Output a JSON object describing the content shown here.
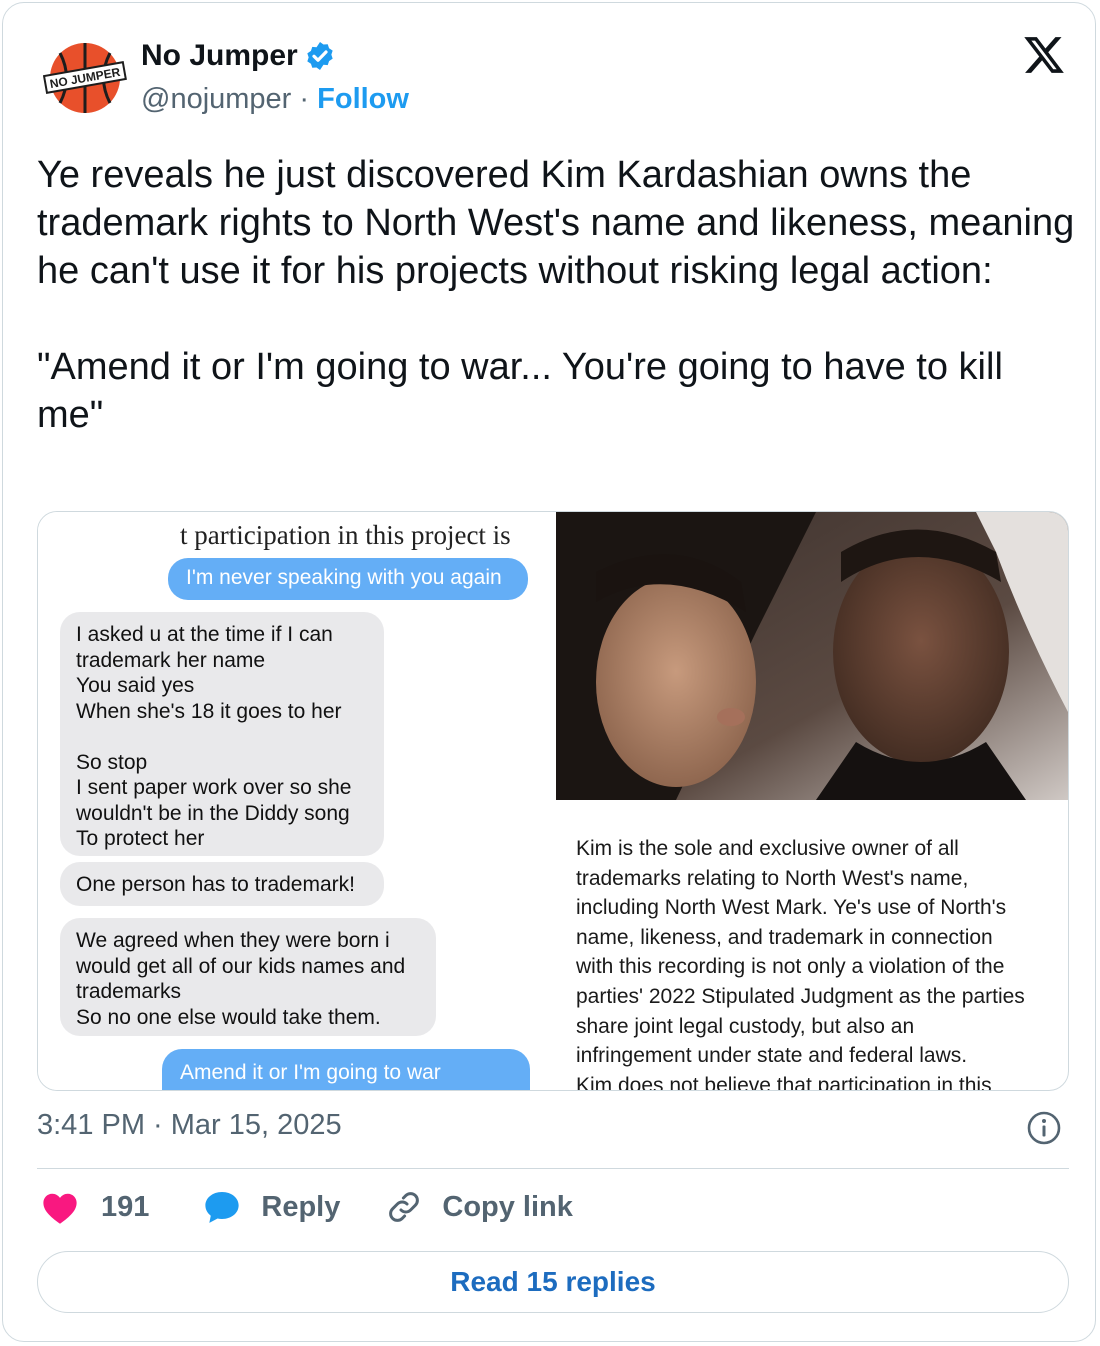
{
  "header": {
    "display_name": "No Jumper",
    "handle": "@nojumper",
    "separator": "·",
    "follow_label": "Follow",
    "avatar_text": "NO JUMPER"
  },
  "tweet": {
    "text": "Ye reveals he just discovered Kim Kardashian owns the trademark rights to North West's name and likeness, meaning he can't use it for his projects without risking legal action:\n\n\"Amend it or I'm going to war... You're going to have to kill me\""
  },
  "media": {
    "chat": {
      "header_fragment": "t participation in this project is",
      "msg1": "I'm never speaking with you again",
      "msg2": "I asked u at the time if I can\ntrademark her name\nYou said yes\nWhen she's 18 it goes to her\n\nSo stop\nI sent paper work over so she\nwouldn't be in the Diddy song\nTo protect her",
      "msg3": "One person has to trademark!",
      "msg4": "We agreed when they were born i\nwould get all of our kids names and\ntrademarks\nSo no one else would take them.",
      "msg5": "Amend it or I'm going to war"
    },
    "document_text": "Kim is the sole and exclusive owner of all\ntrademarks relating to North West's name,\nincluding North West Mark. Ye's use of North's\nname, likeness, and trademark in connection\nwith this recording is not only a violation of the\nparties' 2022 Stipulated Judgment as the parties\nshare joint legal custody, but also an\ninfringement under state and federal laws.\nKim does not believe that participation in this"
  },
  "footer": {
    "timestamp": "3:41 PM · Mar 15, 2025",
    "likes": "191",
    "reply_label": "Reply",
    "copy_link_label": "Copy link",
    "read_replies_label": "Read 15 replies"
  },
  "colors": {
    "accent": "#1d9bf0",
    "like": "#f91880",
    "muted": "#536471",
    "border": "#cfd9de",
    "chat_blue": "#64aef6",
    "chat_gray": "#e9e9eb"
  },
  "icons": [
    "verified-badge-icon",
    "x-logo-icon",
    "info-icon",
    "heart-icon",
    "reply-icon",
    "link-icon"
  ]
}
